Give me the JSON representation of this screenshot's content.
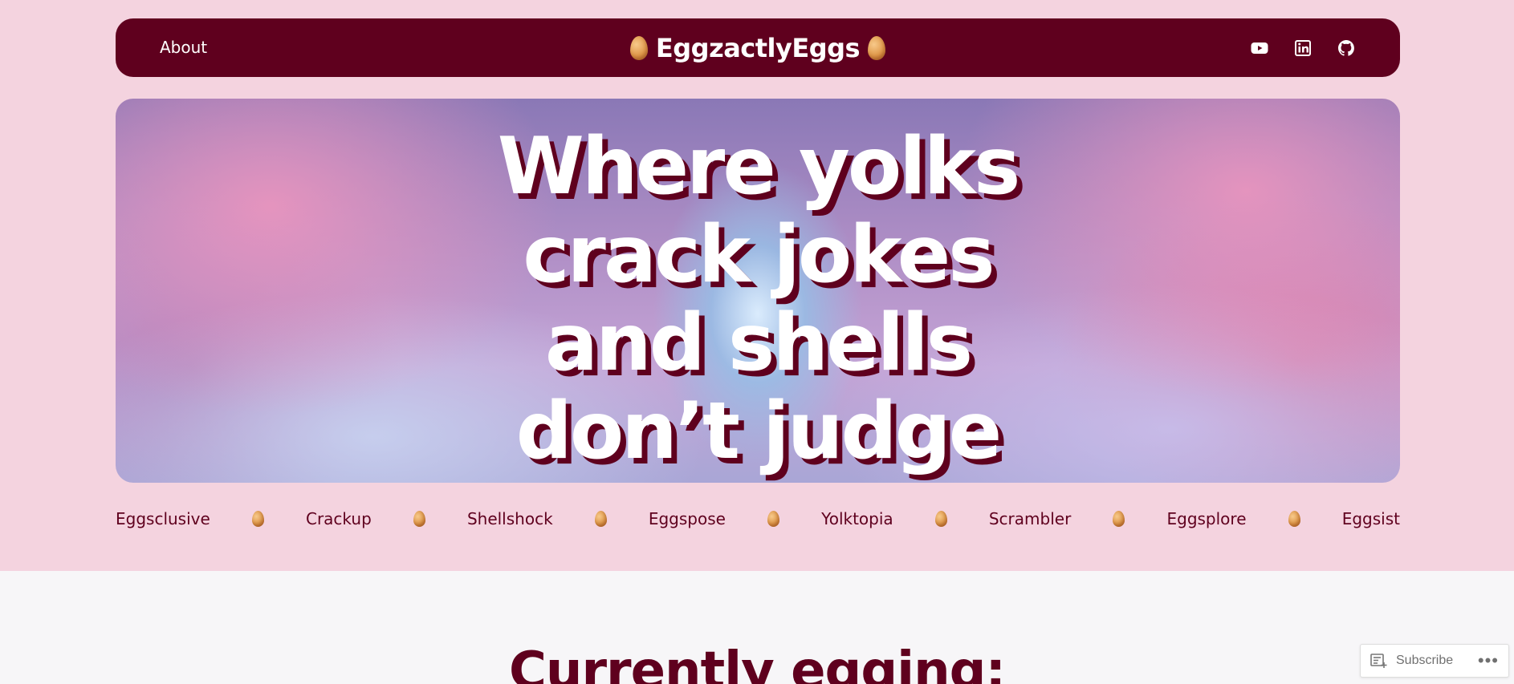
{
  "header": {
    "nav_link": "About",
    "site_title": "EggzactlyEggs",
    "social_icons": [
      "youtube-icon",
      "linkedin-icon",
      "github-icon"
    ]
  },
  "hero": {
    "headline_lines": [
      "Where yolks",
      "crack jokes",
      "and shells",
      "don’t judge"
    ]
  },
  "categories": [
    "Eggsclusive",
    "Crackup",
    "Shellshock",
    "Eggspose",
    "Yolktopia",
    "Scrambler",
    "Eggsplore",
    "Eggsist"
  ],
  "main": {
    "section_title": "Currently egging:"
  },
  "subscribe_bar": {
    "subscribe_label": "Subscribe",
    "more_label": "•••"
  },
  "colors": {
    "brand": "#5f001e",
    "page_pink": "#f4d3df",
    "page_light": "#f7f6f8"
  }
}
